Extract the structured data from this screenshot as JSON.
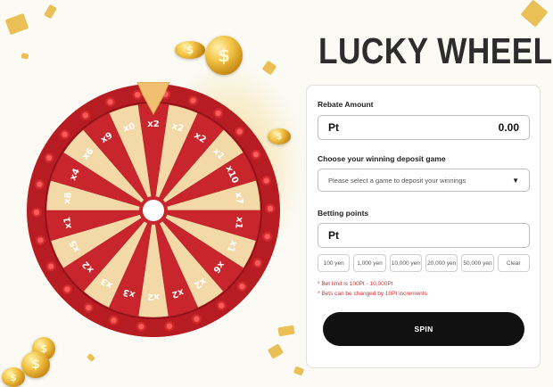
{
  "title": "LUCKY WHEEL",
  "wheel": {
    "segments": [
      "x2",
      "x2",
      "x2",
      "x1",
      "x10",
      "x7",
      "x1",
      "x1",
      "x6",
      "x2",
      "x2",
      "x2",
      "x3",
      "x3",
      "x2",
      "x5",
      "x1",
      "x8",
      "x4",
      "x6",
      "x9",
      "x0"
    ],
    "colors": {
      "red": "#c9252c",
      "cream": "#f4d9a8",
      "rim": "#b71c22",
      "pointer": "#f0c070"
    }
  },
  "form": {
    "rebate": {
      "label": "Rebate Amount",
      "prefix": "Pt",
      "value": "0.00"
    },
    "game": {
      "label": "Choose your winning deposit game",
      "placeholder": "Please select a game to deposit your winnings",
      "caret": "▼"
    },
    "betting": {
      "label": "Betting points",
      "prefix": "Pt"
    },
    "quick_amounts": [
      "100 yen",
      "1,000 yen",
      "10,000 yen",
      "20,000 yen",
      "50,000 yen",
      "Clear"
    ],
    "notes": [
      "* Bet limit is 100Pt - 10,000Pt",
      "* Bets can be changed by 10Pt increments"
    ],
    "spin_label": "SPIN"
  }
}
